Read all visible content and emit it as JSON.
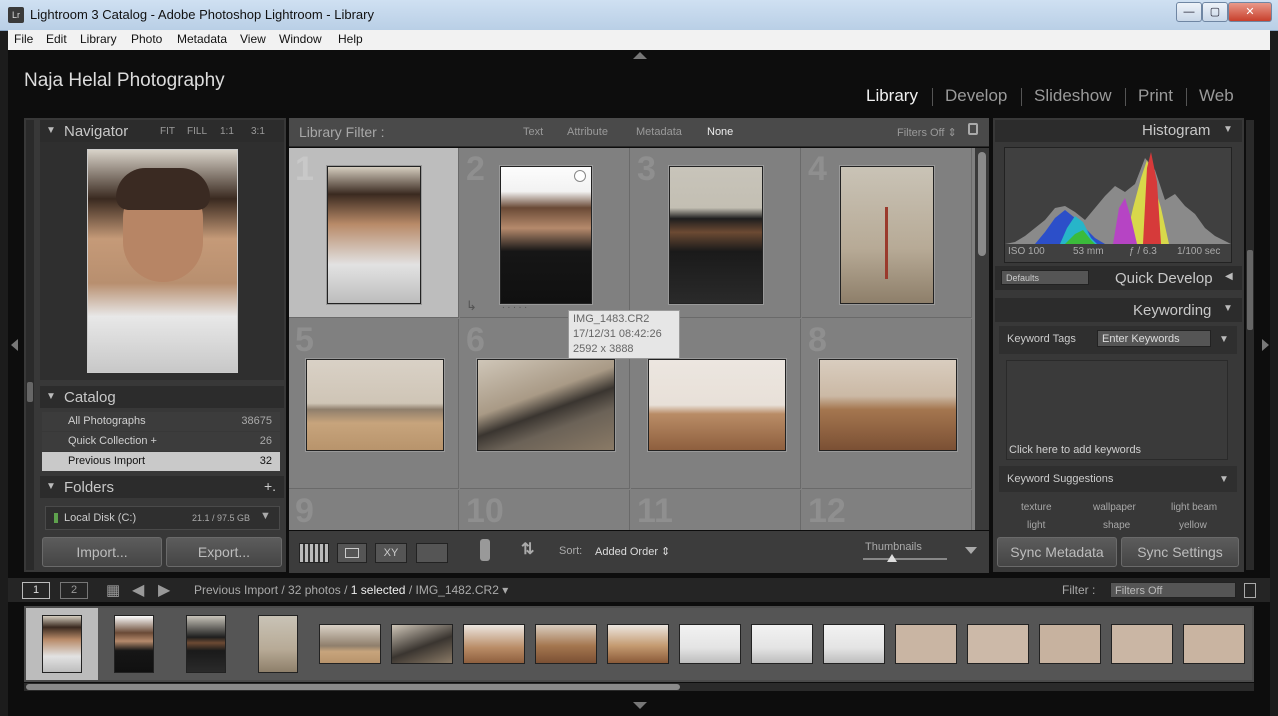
{
  "window": {
    "app_icon": "Lr",
    "title": "Lightroom 3 Catalog - Adobe Photoshop Lightroom - Library",
    "min": "—",
    "restore": "▢",
    "close": "✕"
  },
  "menu": [
    "File",
    "Edit",
    "Library",
    "Photo",
    "Metadata",
    "View",
    "Window",
    "Help"
  ],
  "identity_plate": "Naja Helal Photography",
  "modules": [
    "Library",
    "Develop",
    "Slideshow",
    "Print",
    "Web"
  ],
  "navigator": {
    "title": "Navigator",
    "zoom_options": [
      "FIT",
      "FILL",
      "1:1",
      "3:1"
    ]
  },
  "catalog": {
    "title": "Catalog",
    "items": [
      {
        "label": "All Photographs",
        "count": "38675"
      },
      {
        "label": "Quick Collection  +",
        "count": "26"
      },
      {
        "label": "Previous Import",
        "count": "32"
      }
    ]
  },
  "folders": {
    "title": "Folders",
    "add": "+.",
    "disk_label": "Local Disk (C:)",
    "disk_usage": "21.1 / 97.5 GB"
  },
  "import_label": "Import...",
  "export_label": "Export...",
  "library_filter": {
    "title": "Library Filter :",
    "tabs": [
      "Text",
      "Attribute",
      "Metadata",
      "None"
    ],
    "preset": "Filters Off ⇕"
  },
  "grid": {
    "cells": [
      "1",
      "2",
      "3",
      "4",
      "5",
      "6",
      "7",
      "8",
      "9",
      "10",
      "11",
      "12"
    ],
    "tooltip": {
      "filename": "IMG_1483.CR2",
      "date": "17/12/31 08:42:26",
      "dimensions": "2592 x 3888"
    },
    "dots": ". . . . ."
  },
  "toolbar": {
    "sort_label": "Sort:",
    "sort_value": "Added Order ⇕",
    "thumbnails_label": "Thumbnails"
  },
  "histogram": {
    "title": "Histogram",
    "iso": "ISO 100",
    "focal": "53 mm",
    "aperture": "ƒ / 6.3",
    "shutter": "1/100 sec"
  },
  "quick_develop": {
    "title": "Quick Develop",
    "preset": "Defaults"
  },
  "keywording": {
    "title": "Keywording",
    "tags_label": "Keyword Tags",
    "tags_mode": "Enter Keywords",
    "add_hint": "Click here to add keywords",
    "suggestions_title": "Keyword Suggestions",
    "suggestions": [
      "texture",
      "wallpaper",
      "light beam",
      "light",
      "shape",
      "yellow"
    ]
  },
  "sync_metadata": "Sync Metadata",
  "sync_settings": "Sync Settings",
  "filmstrip": {
    "view1": "1",
    "view2": "2",
    "source": "Previous Import",
    "sep1": " / ",
    "count": "32 photos",
    "sep2": " / ",
    "selected": "1 selected",
    "sep3": " / ",
    "filename": "IMG_1482.CR2 ▾",
    "filter_label": "Filter :",
    "filter_value": "Filters Off"
  },
  "colors": {
    "accent_white": "#f0f0f0",
    "panel_bg": "#383838",
    "grid_bg": "#808080"
  }
}
